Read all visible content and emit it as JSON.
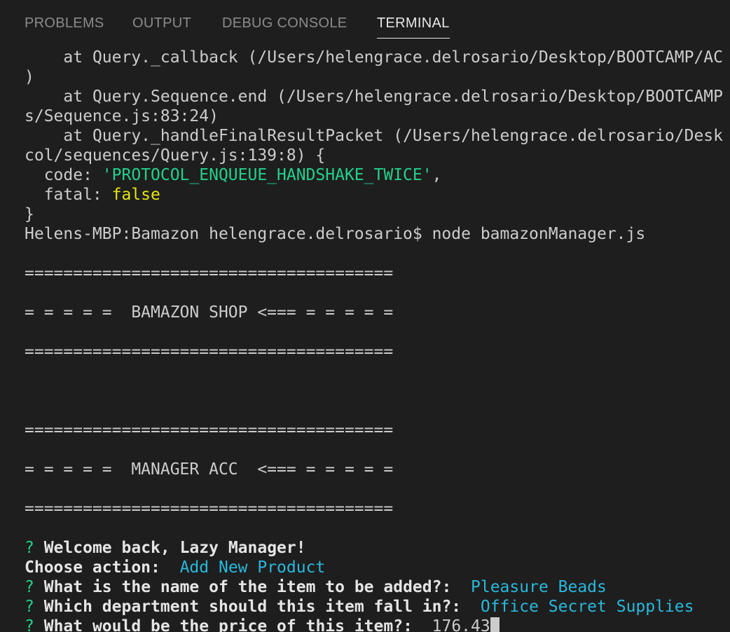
{
  "tabs": [
    {
      "label": "PROBLEMS"
    },
    {
      "label": "OUTPUT"
    },
    {
      "label": "DEBUG CONSOLE"
    },
    {
      "label": "TERMINAL"
    }
  ],
  "terminal": {
    "trace1": "  at Query._callback (/Users/helengrace.delrosario/Desktop/BOOTCAMP/AC",
    "trace1_end": ")",
    "trace2": "  at Query.Sequence.end (/Users/helengrace.delrosario/Desktop/BOOTCAMP",
    "trace2_end": "s/Sequence.js:83:24)",
    "trace3": "  at Query._handleFinalResultPacket (/Users/helengrace.delrosario/Desk",
    "trace3_end": "col/sequences/Query.js:139:8) {",
    "code_key": "  code: ",
    "code_value": "'PROTOCOL_ENQUEUE_HANDSHAKE_TWICE'",
    "code_comma": ",",
    "fatal_key": "  fatal: ",
    "fatal_value": "false",
    "close_brace": "}",
    "prompt": "Helens-MBP:Bamazon helengrace.delrosario$ node bamazonManager.js",
    "divider": "======================================",
    "shop_banner": "= = = = =  BAMAZON SHOP <=== = = = = =",
    "manager_banner": "= = = = =  MANAGER ACC  <=== = = = = =",
    "q_mark": "?",
    "welcome": "Welcome back, Lazy Manager!",
    "choose_label": "Choose action:",
    "choose_value": "Add New Product",
    "q1_label": "What is the name of the item to be added?:",
    "q1_value": "Pleasure Beads",
    "q2_label": "Which department should this item fall in?:",
    "q2_value": "Office Secret Supplies",
    "q3_label": "What would be the price of this item?:",
    "q3_value": "176.43"
  }
}
